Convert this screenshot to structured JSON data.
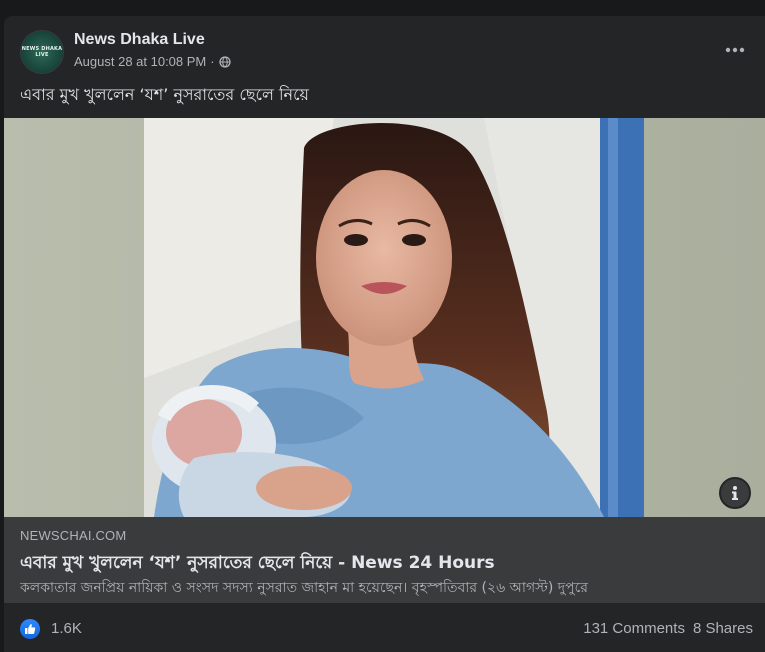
{
  "post": {
    "page_name": "News Dhaka Live",
    "avatar_text": "NEWS DHAKA LIVE",
    "timestamp": "August 28 at 10:08 PM",
    "separator": "·",
    "text": "এবার মুখ খুললেন ‘যশ’ নুসরাতের ছেলে নিয়ে"
  },
  "link_preview": {
    "domain": "NEWSCHAI.COM",
    "title": "এবার মুখ খুললেন ‘যশ’ নুসরাতের ছেলে নিয়ে - News 24 Hours",
    "description": "কলকাতার জনপ্রিয় নায়িকা ও সংসদ সদস্য নুসরাত জাহান মা হয়েছেন। বৃহস্পতিবার (২৬ আগস্ট) দুপুরে"
  },
  "footer": {
    "reaction_count": "1.6K",
    "comments": "131 Comments",
    "shares": "8 Shares"
  },
  "icons": {
    "more": "more-horizontal-icon",
    "globe": "globe-icon",
    "info": "info-icon",
    "like": "like-icon"
  },
  "colors": {
    "background": "#18191a",
    "card": "#242526",
    "link_box": "#3a3b3c",
    "like_blue": "#2e89ff"
  }
}
